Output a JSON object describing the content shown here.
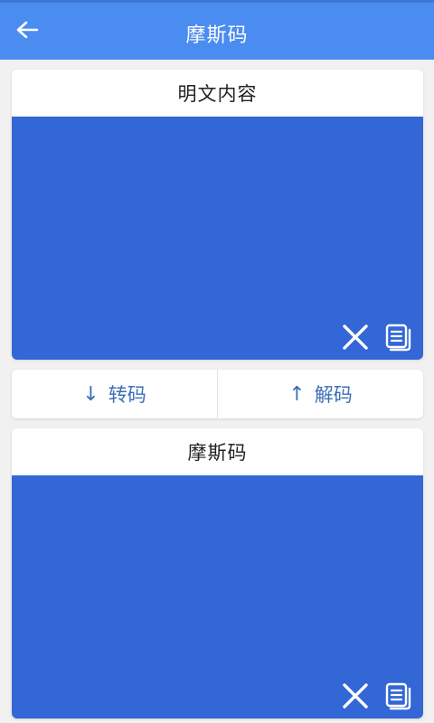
{
  "header": {
    "title": "摩斯码"
  },
  "plain_card": {
    "title": "明文内容",
    "value": ""
  },
  "convert": {
    "encode_arrow": "↓",
    "encode_label": "转码",
    "decode_arrow": "↑",
    "decode_label": "解码"
  },
  "morse_card": {
    "title": "摩斯码",
    "value": ""
  },
  "icons": {
    "back": "arrow-left",
    "clear": "close-x",
    "copy": "copy-document"
  },
  "colors": {
    "topbar": "#4a8cf0",
    "panel": "#3367d6",
    "button_text": "#3d6fb6",
    "background": "#f1f1f1"
  }
}
